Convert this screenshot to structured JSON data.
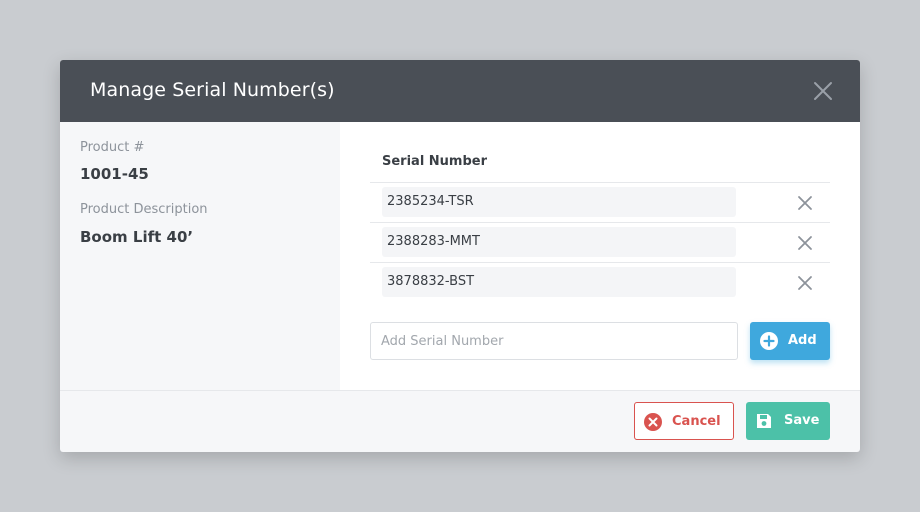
{
  "dialog": {
    "title": "Manage Serial Number(s)",
    "close_icon": "close-icon"
  },
  "product": {
    "number_label": "Product #",
    "number_value": "1001-45",
    "description_label": "Product Description",
    "description_value": "Boom Lift 40’"
  },
  "serials": {
    "column_header": "Serial Number",
    "items": [
      {
        "value": "2385234-TSR"
      },
      {
        "value": "2388283-MMT"
      },
      {
        "value": "3878832-BST"
      }
    ],
    "remove_icon": "close-icon"
  },
  "add_form": {
    "input_value": "",
    "input_placeholder": "Add Serial Number",
    "add_label": "Add",
    "add_icon": "plus-circle-icon"
  },
  "footer": {
    "cancel_label": "Cancel",
    "cancel_icon": "x-circle-icon",
    "save_label": "Save",
    "save_icon": "floppy-disk-icon"
  },
  "colors": {
    "header_bg": "#4a4f56",
    "add_button": "#3fa8dd",
    "cancel": "#d9534f",
    "save": "#4cc1a8"
  }
}
